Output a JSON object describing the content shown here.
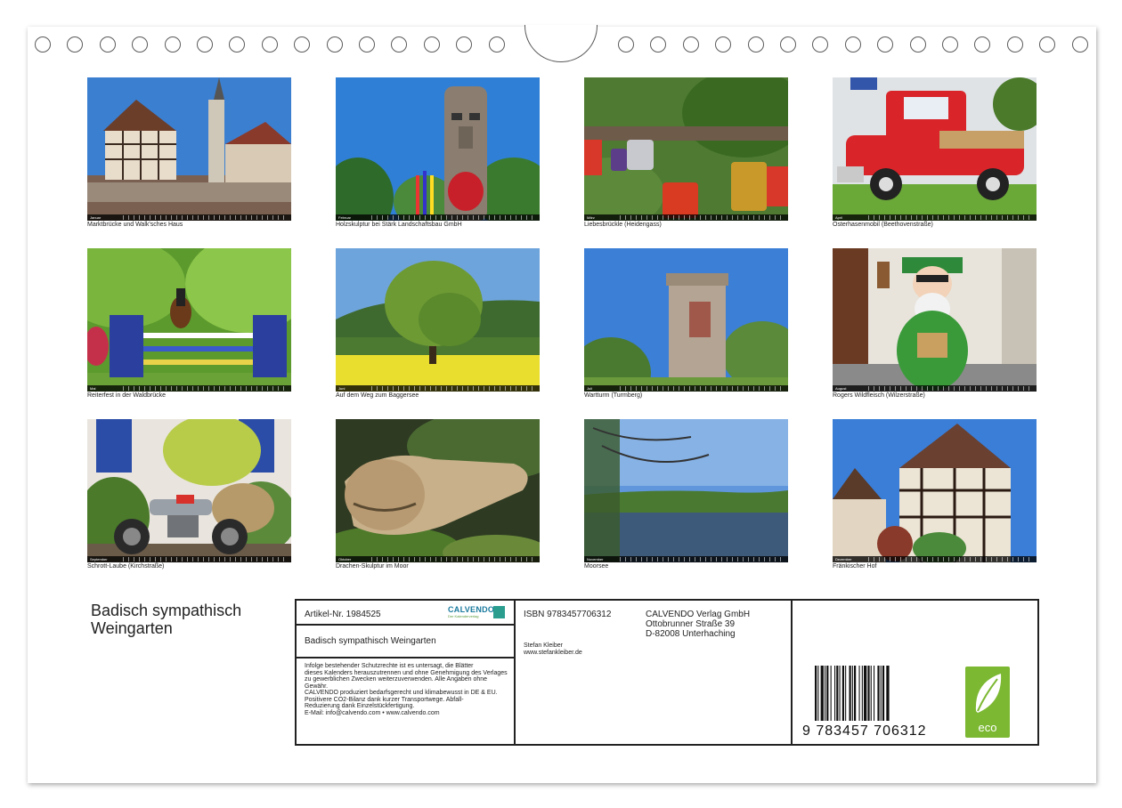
{
  "photos": [
    {
      "caption": "Marktbrücke und Walk'sches Haus",
      "month": "Januar"
    },
    {
      "caption": "Holzskulptur bei Stärk Landschaftsbau GmbH",
      "month": "Februar"
    },
    {
      "caption": "Liebesbrückle (Heidengass)",
      "month": "März"
    },
    {
      "caption": "Osterhasenmobil (Beethovenstraße)",
      "month": "April"
    },
    {
      "caption": "Reiterfest in der Waldbrücke",
      "month": "Mai"
    },
    {
      "caption": "Auf dem Weg zum Baggersee",
      "month": "Juni"
    },
    {
      "caption": "Wartturm (Turmberg)",
      "month": "Juli"
    },
    {
      "caption": "Rogers Wildfleisch (Wilzerstraße)",
      "month": "August"
    },
    {
      "caption": "Schrott-Laube (Kirchstraße)",
      "month": "September"
    },
    {
      "caption": "Drachen-Skulptur im Moor",
      "month": "Oktober"
    },
    {
      "caption": "Moorsee",
      "month": "November"
    },
    {
      "caption": "Fränkischer Hof",
      "month": "Dezember"
    }
  ],
  "title": "Badisch sympathisch Weingarten",
  "title_line1": "Badisch sympathisch",
  "title_line2": "Weingarten",
  "info": {
    "article": "Artikel-Nr. 1984525",
    "calvendo": "CALVENDO",
    "calvendo_sub": "Der Kalenderverlag",
    "product_title": "Badisch sympathisch Weingarten",
    "legal": [
      "Infolge bestehender Schutzrechte ist es untersagt, die Blätter",
      "dieses Kalenders herauszutrennen und ohne Genehmigung des Verlages",
      "zu gewerblichen Zwecken weiterzuverwenden. Alle Angaben ohne",
      "Gewähr.",
      "CALVENDO produziert bedarfsgerecht und klimabewusst in DE & EU.",
      "Positivere CO2-Bilanz dank kurzer Transportwege. Abfall-",
      "Reduzierung dank Einzelstückfertigung.",
      "E-Mail: info@calvendo.com • www.calvendo.com"
    ],
    "isbn": "ISBN 9783457706312",
    "publisher": [
      "CALVENDO Verlag GmbH",
      "Ottobrunner Straße 39",
      "D-82008 Unterhaching"
    ],
    "author": "Stefan Kleiber",
    "author_url": "www.stefankleiber.de",
    "barcode_number": "9  783457  706312",
    "eco_label": "eco"
  }
}
